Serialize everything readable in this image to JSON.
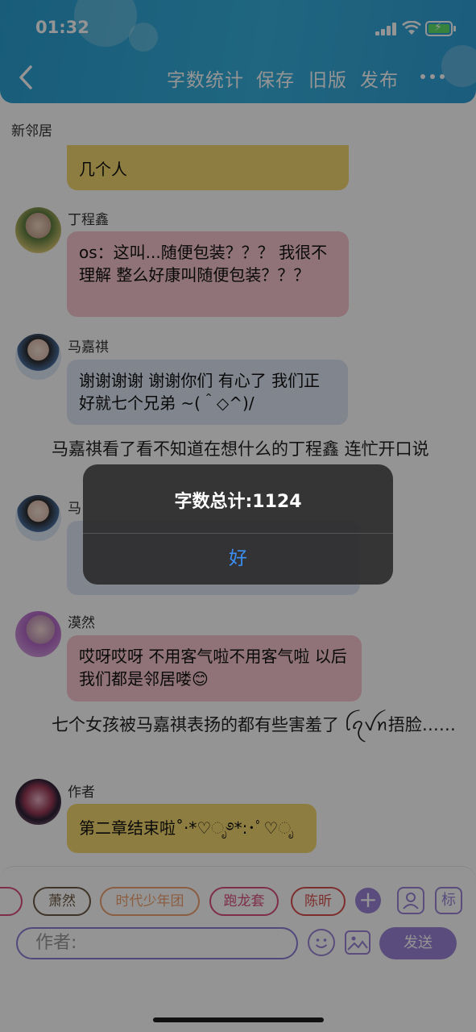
{
  "status_bar": {
    "time": "01:32"
  },
  "header": {
    "nav": [
      "字数统计",
      "保存",
      "旧版",
      "发布"
    ]
  },
  "chat": {
    "title": "新邻居",
    "top_fragment": "几个人",
    "messages": [
      {
        "sender": "丁程鑫",
        "text": "os：这叫...随便包装？？？ 我很不理解 整么好康叫随便包装？？？"
      },
      {
        "sender": "马嘉祺",
        "text": "谢谢谢谢 谢谢你们 有心了 我们正好就七个兄弟 ~(＾◇^)/"
      },
      {
        "sender": "马",
        "text": ""
      },
      {
        "sender": "漠然",
        "text": "哎呀哎呀 不用客气啦不用客气啦 以后我们都是邻居喽😊"
      },
      {
        "sender": "作者",
        "text": "第二章结束啦˚‧*♡ೃ࿔*:･ﾟ♡ೃ"
      }
    ],
    "narration": [
      "马嘉祺看了看不知道在想什么的丁程鑫 连忙开口说",
      "七个女孩被马嘉祺表扬的都有些害羞了 ꪶꪖꪜꪀ捂脸……"
    ]
  },
  "toolbar": {
    "chips": [
      "萧然",
      "时代少年团",
      "跑龙套",
      "陈昕"
    ],
    "label_button": "标",
    "author_placeholder": "作者:",
    "send_label": "发送"
  },
  "dialog": {
    "title": "字数总计:1124",
    "ok_label": "好"
  },
  "colors": {
    "header": "#2fa6d8",
    "accent": "#9b86d8",
    "dialog_button": "#3a8ff5"
  }
}
